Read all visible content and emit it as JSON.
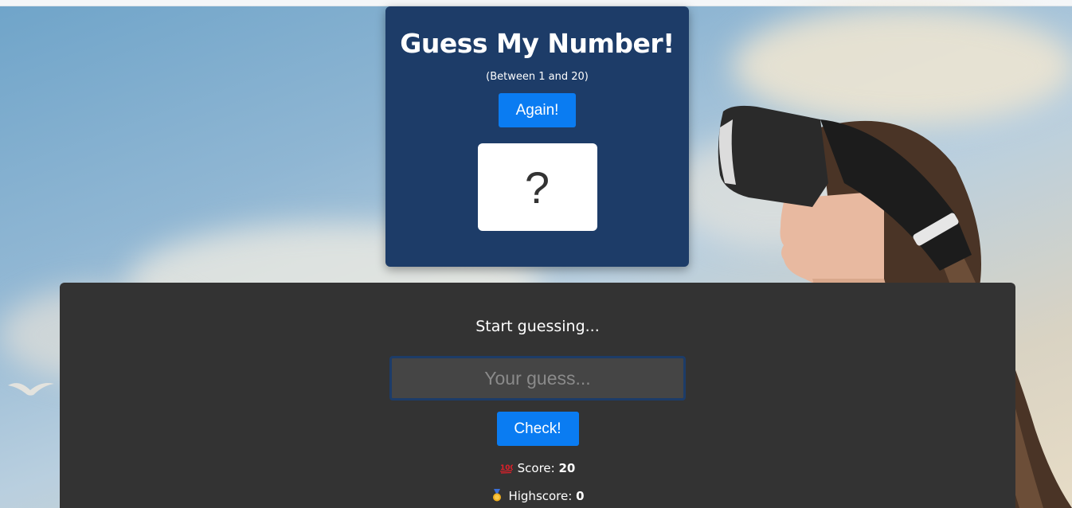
{
  "header": {
    "title": "Guess My Number!",
    "subtitle": "(Between 1 and 20)",
    "again_label": "Again!",
    "secret_number": "?"
  },
  "game": {
    "message": "Start guessing...",
    "guess_placeholder": "Your guess...",
    "guess_value": "",
    "check_label": "Check!",
    "score_label": "Score:",
    "score_value": "20",
    "score_icon": "hundred-points-icon",
    "highscore_label": "Highscore:",
    "highscore_value": "0",
    "highscore_icon": "medal-icon"
  },
  "colors": {
    "header_bg": "#1d3c68",
    "panel_bg": "#333333",
    "button": "#0a7cf2",
    "input_bg": "#454545"
  }
}
